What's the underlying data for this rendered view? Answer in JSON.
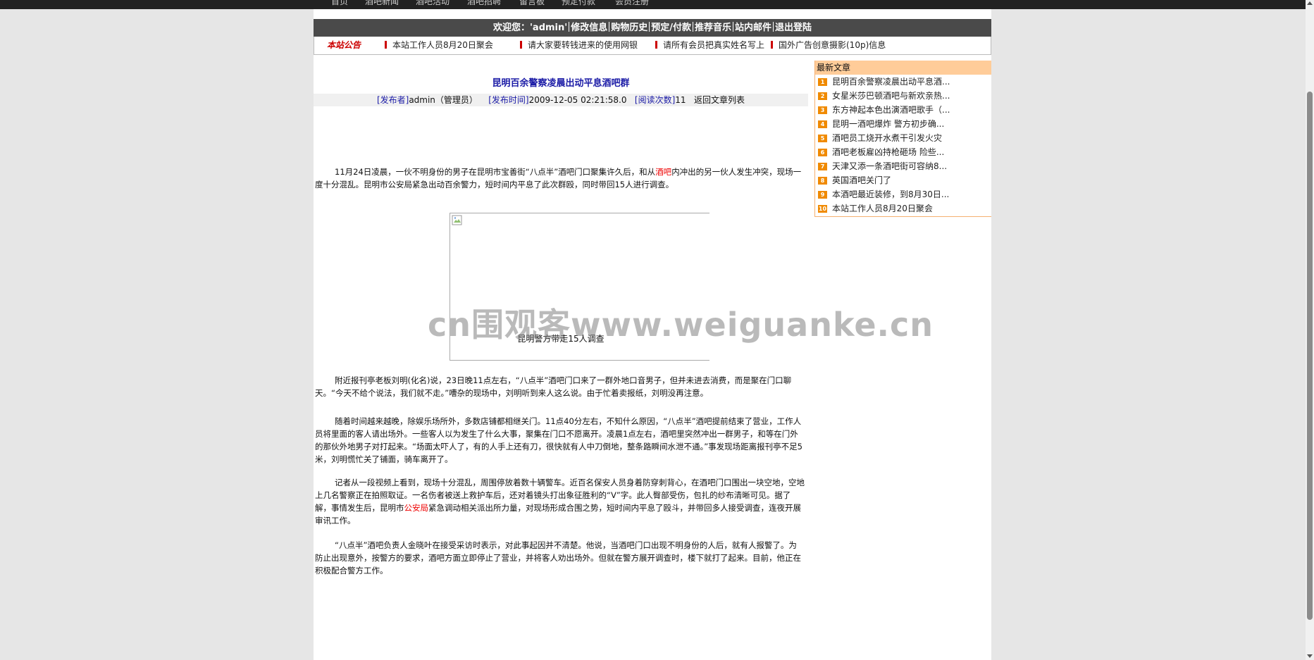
{
  "topnav": {
    "items": [
      "首页",
      "酒吧新闻",
      "酒吧活动",
      "酒吧招聘",
      "留言板",
      "预定付款",
      "会员注册"
    ]
  },
  "welcome": {
    "greeting": "欢迎您：'admin'",
    "links": [
      "修改信息",
      "购物历史",
      "预定/付款",
      "推荐音乐",
      "站内邮件",
      "退出登陆"
    ]
  },
  "notice": {
    "label": "本站公告",
    "items": [
      "本站工作人员8月20日聚会",
      "请大家要转钱进来的使用网银",
      "请所有会员把真实姓名写上",
      "国外广告创意摄影(10p)信息"
    ]
  },
  "article": {
    "title": "昆明百余警察凌晨出动平息酒吧群",
    "meta": {
      "publisher_label": "[发布者]",
      "publisher": "admin（管理员）",
      "time_label": "[发布时间]",
      "time": "2009-12-05 02:21:58.0",
      "reads_label": "[阅读次数]",
      "reads": "11",
      "back": "返回文章列表"
    },
    "p1_a": "11月24日凌晨，一伙不明身份的男子在昆明市宝善街“八点半”酒吧门口聚集许久后，和从",
    "p1_red": "酒吧",
    "p1_b": "内冲出的另一伙人发生冲突，现场一度十分混乱。昆明市公安局紧急出动百余警力，短时间内平息了此次群殴，同时带回15人进行调查。",
    "caption": "昆明警方带走15人调查",
    "p2": "附近报刊亭老板刘明(化名)说，23日晚11点左右，“八点半”酒吧门口来了一群外地口音男子，但并未进去消费，而是聚在门口聊天。“今天不给个说法，我们就不走。”嘈杂的现场中，刘明听到来人这么说。由于忙着卖报纸，刘明没再注意。",
    "p3": "随着时间越来越晚，除娱乐场所外，多数店铺都相继关门。11点40分左右，不知什么原因，“八点半”酒吧提前结束了营业，工作人员将里面的客人请出场外。一些客人以为发生了什么大事，聚集在门口不愿离开。凌晨1点左右，酒吧里突然冲出一群男子，和等在门外的那伙外地男子对打起来。“场面太吓人了，有的人手上还有刀，很快就有人中刀倒地，整条路瞬间水泄不通。”事发现场距离报刊亭不足5米，刘明慌忙关了铺面，骑车离开了。",
    "p4_a": "记者从一段视频上看到，现场十分混乱，周围停放着数十辆警车。近百名保安人员身着防穿刺背心，在酒吧门口围出一块空地，空地上几名警察正在拍照取证。一名伤者被送上救护车后，还对着镜头打出象征胜利的“V”字。此人臀部受伤，包扎的纱布清晰可见。据了解，事情发生后，昆明市",
    "p4_red": "公安局",
    "p4_b": "紧急调动相关派出所力量，对现场形成合围之势，短时间内平息了殴斗，并带回多人接受调查，连夜开展审讯工作。",
    "p5": "“八点半”酒吧负责人金晓叶在接受采访时表示，对此事起因并不清楚。他说，当酒吧门口出现不明身份的人后，就有人报警了。为防止出现意外，按警方的要求，酒吧方面立即停止了营业，并将客人劝出场外。但就在警方展开调查时，楼下就打了起来。目前，他正在积极配合警方工作。"
  },
  "sidebar": {
    "title": "最新文章",
    "items": [
      {
        "num": "1",
        "text": "昆明百余警察凌晨出动平息酒..."
      },
      {
        "num": "2",
        "text": "女星米莎巴顿酒吧与新欢亲热..."
      },
      {
        "num": "3",
        "text": "东方神起本色出演酒吧歌手（..."
      },
      {
        "num": "4",
        "text": "昆明一酒吧爆炸 警方初步确..."
      },
      {
        "num": "5",
        "text": "酒吧员工烧开水煮干引发火灾"
      },
      {
        "num": "6",
        "text": "酒吧老板雇凶持枪砸场 险些..."
      },
      {
        "num": "7",
        "text": "天津又添一条酒吧街可容纳8..."
      },
      {
        "num": "8",
        "text": "英国酒吧关门了"
      },
      {
        "num": "9",
        "text": "本酒吧最近装修，到8月30日..."
      },
      {
        "num": "10",
        "text": "本站工作人员8月20日聚会"
      }
    ]
  },
  "watermark": "cn围观客www.weiguanke.cn",
  "colors": {
    "header": "#4a4a4a",
    "accent_red": "#cc0000",
    "link_blue": "#1a1aa6",
    "side_head": "#ffcc99",
    "side_num": "#f08a00"
  }
}
